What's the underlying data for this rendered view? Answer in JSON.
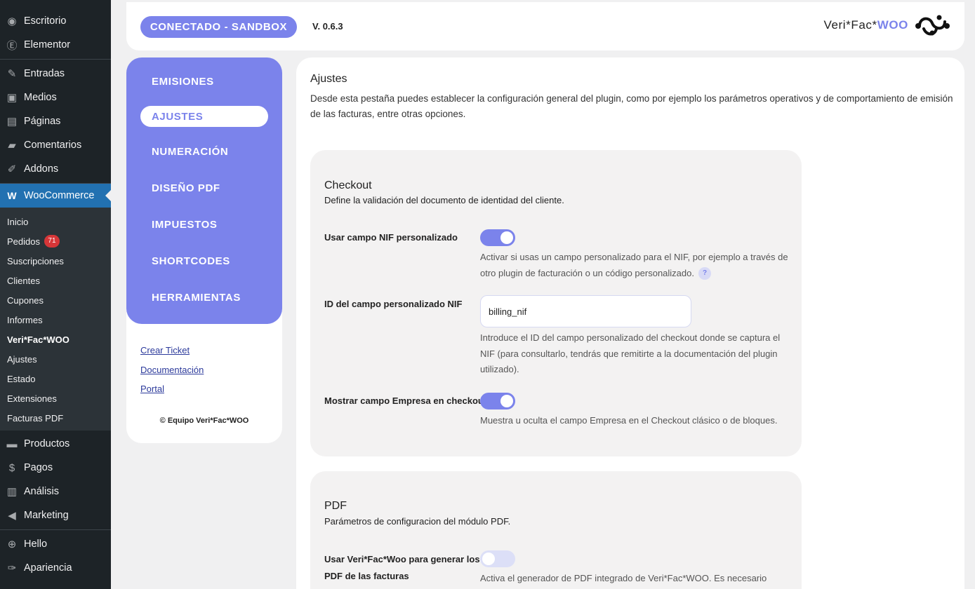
{
  "admin_menu": {
    "top_items": [
      {
        "icon": "dashboard-icon",
        "glyph": "◉",
        "label": "Escritorio"
      },
      {
        "icon": "elementor-icon",
        "glyph": "Ⓔ",
        "label": "Elementor"
      }
    ],
    "mid_items": [
      {
        "icon": "pin-icon",
        "glyph": "✎",
        "label": "Entradas"
      },
      {
        "icon": "media-icon",
        "glyph": "▣",
        "label": "Medios"
      },
      {
        "icon": "pages-icon",
        "glyph": "▤",
        "label": "Páginas"
      },
      {
        "icon": "comments-icon",
        "glyph": "▰",
        "label": "Comentarios"
      },
      {
        "icon": "addons-icon",
        "glyph": "✐",
        "label": "Addons"
      }
    ],
    "woocommerce": {
      "icon": "woocommerce-icon",
      "glyph": "W",
      "label": "WooCommerce"
    },
    "woo_submenu": [
      {
        "label": "Inicio"
      },
      {
        "label": "Pedidos",
        "badge": "71"
      },
      {
        "label": "Suscripciones"
      },
      {
        "label": "Clientes"
      },
      {
        "label": "Cupones"
      },
      {
        "label": "Informes"
      },
      {
        "label": "Veri*Fac*WOO",
        "current": true
      },
      {
        "label": "Ajustes"
      },
      {
        "label": "Estado"
      },
      {
        "label": "Extensiones"
      },
      {
        "label": "Facturas PDF"
      }
    ],
    "bottom_items": [
      {
        "icon": "products-icon",
        "glyph": "▬",
        "label": "Productos"
      },
      {
        "icon": "payments-icon",
        "glyph": "$",
        "label": "Pagos"
      },
      {
        "icon": "analytics-icon",
        "glyph": "▥",
        "label": "Análisis"
      },
      {
        "icon": "marketing-icon",
        "glyph": "◀",
        "label": "Marketing"
      }
    ],
    "extra_items": [
      {
        "icon": "plus-circle-icon",
        "glyph": "⊕",
        "label": "Hello"
      },
      {
        "icon": "brush-icon",
        "glyph": "✑",
        "label": "Apariencia"
      }
    ]
  },
  "header": {
    "connection_badge": "CONECTADO - SANDBOX",
    "version": "V. 0.6.3",
    "brand_prefix": "Veri*Fac*",
    "brand_suffix": "WOO"
  },
  "plugin_nav": {
    "items": [
      "EMISIONES",
      "AJUSTES",
      "NUMERACIÓN",
      "DISEÑO PDF",
      "IMPUESTOS",
      "SHORTCODES",
      "HERRAMIENTAS"
    ],
    "active": "AJUSTES",
    "links": [
      "Crear Ticket",
      "Documentación",
      "Portal"
    ],
    "copyright": "© Equipo Veri*Fac*WOO"
  },
  "main": {
    "title": "Ajustes",
    "description": "Desde esta pestaña puedes establecer la configuración general del plugin, como por ejemplo los parámetros operativos y de comportamiento de emisión de las facturas, entre otras opciones."
  },
  "checkout": {
    "title": "Checkout",
    "subtitle": "Define la validación del documento de identidad del cliente.",
    "nif_custom_label": "Usar campo NIF personalizado",
    "nif_custom_enabled": true,
    "nif_custom_help": "Activar si usas un campo personalizado para el NIF, por ejemplo a través de otro plugin de facturación o un código personalizado.",
    "help_mark": "?",
    "nif_field_label": "ID del campo personalizado NIF",
    "nif_field_value": "billing_nif",
    "nif_field_help": "Introduce el ID del campo personalizado del checkout donde se captura el NIF (para consultarlo, tendrás que remitirte a la documentación del plugin utilizado).",
    "empresa_label": "Mostrar campo Empresa en checkout",
    "empresa_enabled": true,
    "empresa_help": "Muestra u oculta el campo Empresa en el Checkout clásico o de bloques."
  },
  "pdf": {
    "title": "PDF",
    "subtitle": "Parámetros de configuracion del módulo PDF.",
    "use_pdf_label": "Usar Veri*Fac*Woo para generar los PDF de las facturas",
    "use_pdf_enabled": false,
    "use_pdf_help": "Activa el generador de PDF integrado de Veri*Fac*WOO. Es necesario"
  }
}
